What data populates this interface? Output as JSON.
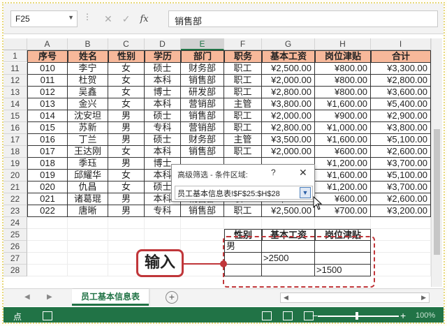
{
  "formula_bar": {
    "name_box": "F25",
    "formula": "销售部",
    "fx_label": "fx"
  },
  "columns": [
    "A",
    "B",
    "C",
    "D",
    "E",
    "F",
    "G",
    "H",
    "I"
  ],
  "header_row": {
    "row": "1",
    "cells": [
      "序号",
      "姓名",
      "性别",
      "学历",
      "部门",
      "职务",
      "基本工资",
      "岗位津贴",
      "合计"
    ]
  },
  "rows": [
    {
      "row": "11",
      "cells": [
        "010",
        "李宁",
        "女",
        "硕士",
        "财务部",
        "职工",
        "¥2,500.00",
        "¥800.00",
        "¥3,300.00"
      ]
    },
    {
      "row": "12",
      "cells": [
        "011",
        "杜贺",
        "女",
        "本科",
        "销售部",
        "职工",
        "¥2,000.00",
        "¥800.00",
        "¥2,800.00"
      ]
    },
    {
      "row": "13",
      "cells": [
        "012",
        "吴鑫",
        "女",
        "博士",
        "研发部",
        "职工",
        "¥2,800.00",
        "¥800.00",
        "¥3,600.00"
      ]
    },
    {
      "row": "14",
      "cells": [
        "013",
        "金兴",
        "女",
        "本科",
        "营销部",
        "主管",
        "¥3,800.00",
        "¥1,600.00",
        "¥5,400.00"
      ]
    },
    {
      "row": "15",
      "cells": [
        "014",
        "沈安坦",
        "男",
        "硕士",
        "销售部",
        "职工",
        "¥2,000.00",
        "¥900.00",
        "¥2,900.00"
      ]
    },
    {
      "row": "16",
      "cells": [
        "015",
        "苏新",
        "男",
        "专科",
        "营销部",
        "职工",
        "¥2,800.00",
        "¥1,000.00",
        "¥3,800.00"
      ]
    },
    {
      "row": "17",
      "cells": [
        "016",
        "丁兰",
        "男",
        "硕士",
        "财务部",
        "主管",
        "¥3,500.00",
        "¥1,600.00",
        "¥5,100.00"
      ]
    },
    {
      "row": "18",
      "cells": [
        "017",
        "王达刚",
        "女",
        "本科",
        "销售部",
        "职工",
        "¥2,000.00",
        "¥600.00",
        "¥2,600.00"
      ]
    },
    {
      "row": "19",
      "cells": [
        "018",
        "季珏",
        "男",
        "博士",
        "",
        "",
        "",
        "¥1,200.00",
        "¥3,700.00"
      ]
    },
    {
      "row": "20",
      "cells": [
        "019",
        "邱耀华",
        "女",
        "本科",
        "",
        "",
        "",
        "¥1,600.00",
        "¥5,100.00"
      ]
    },
    {
      "row": "21",
      "cells": [
        "020",
        "仇昌",
        "女",
        "硕士",
        "",
        "",
        "",
        "¥1,200.00",
        "¥3,700.00"
      ]
    },
    {
      "row": "22",
      "cells": [
        "021",
        "诸葛琨",
        "男",
        "本科",
        "销售部",
        "职工",
        "¥2,000.00",
        "¥600.00",
        "¥2,600.00"
      ]
    },
    {
      "row": "23",
      "cells": [
        "022",
        "唐晰",
        "男",
        "专科",
        "销售部",
        "职工",
        "¥2,500.00",
        "¥700.00",
        "¥3,200.00"
      ]
    }
  ],
  "empty_rows": [
    "24",
    "25",
    "26",
    "27",
    "28"
  ],
  "criteria": {
    "headers": [
      "性别",
      "基本工资",
      "岗位津贴"
    ],
    "rows": [
      [
        "男",
        "",
        ""
      ],
      [
        "",
        ">2500",
        ""
      ],
      [
        "",
        "",
        ">1500"
      ]
    ]
  },
  "callout_label": "输入",
  "dialog": {
    "title": "高级筛选 - 条件区域:",
    "help": "?",
    "close": "✕",
    "range_value": "员工基本信息表!$F$25:$H$28"
  },
  "sheet_tabs": {
    "active": "员工基本信息表",
    "add": "+"
  },
  "status_bar": {
    "mode": "点",
    "zoom": "100%"
  },
  "accent_color": "#217346",
  "header_fill_color": "#f7b89a",
  "callout_color": "#c0363a"
}
